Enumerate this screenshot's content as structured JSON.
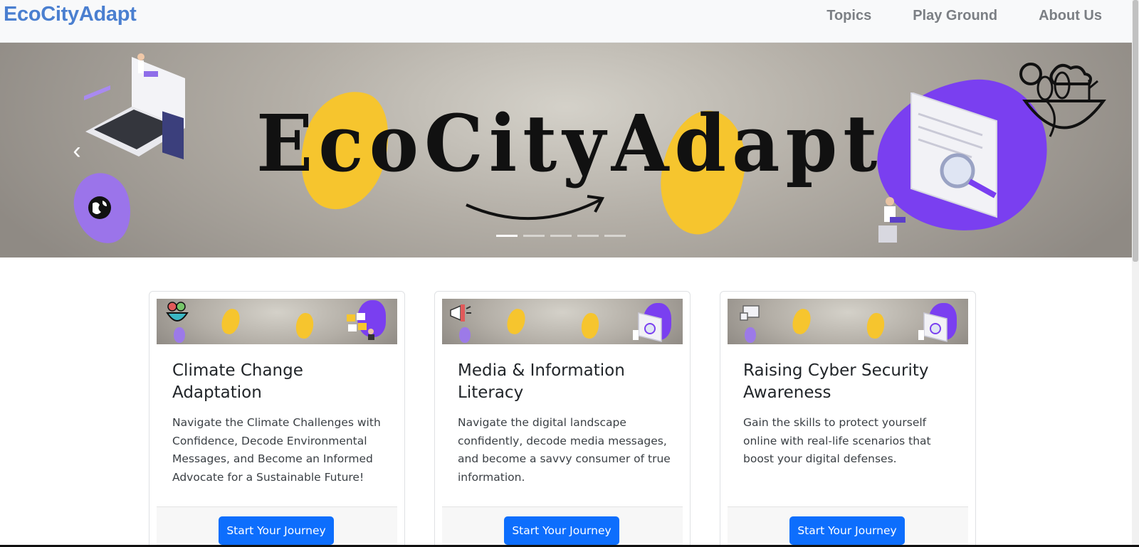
{
  "navbar": {
    "brand": "EcoCityAdapt",
    "links": [
      "Topics",
      "Play Ground",
      "About Us"
    ]
  },
  "carousel": {
    "title": "EcoCityAdapt",
    "prev_icon": "chevron-left-icon",
    "next_icon": "chevron-right-icon",
    "slide_count": 5,
    "active_slide": 1
  },
  "cards": [
    {
      "title": "Climate Change Adaptation",
      "text": "Navigate the Climate Challenges with Confidence, Decode Environmental Messages, and Become an Informed Advocate for a Sustainable Future!",
      "button": "Start Your Journey"
    },
    {
      "title": "Media & Information Literacy",
      "text": "Navigate the digital landscape confidently, decode media messages, and become a savvy consumer of true information.",
      "button": "Start Your Journey"
    },
    {
      "title": "Raising Cyber Security Awareness",
      "text": "Gain the skills to protect yourself online with real-life scenarios that boost your digital defenses.",
      "button": "Start Your Journey"
    }
  ],
  "colors": {
    "brand": "#4a7fd0",
    "button": "#0d6efd",
    "accent_yellow": "#f6c52e",
    "accent_purple": "#7a3ff0"
  }
}
